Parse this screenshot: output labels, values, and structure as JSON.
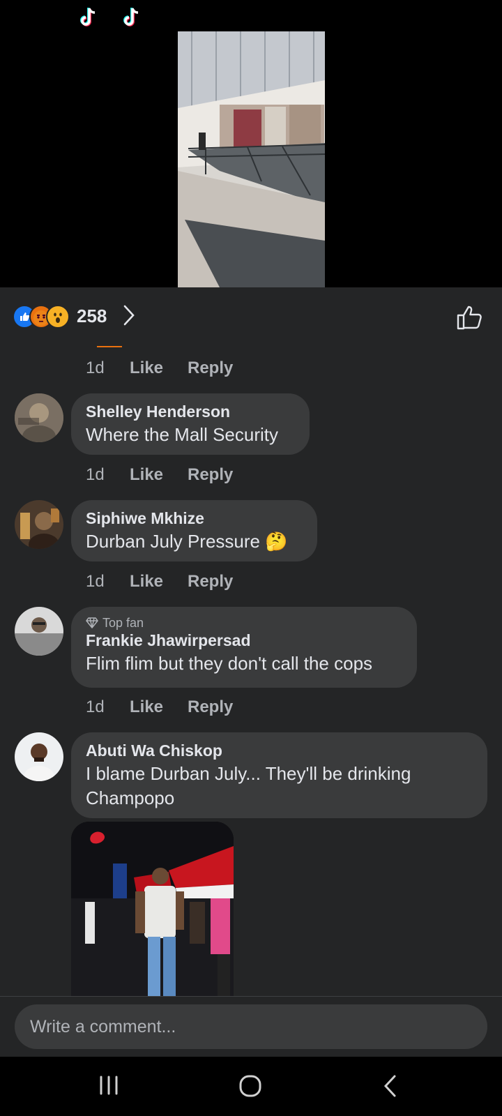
{
  "reactions": {
    "types": [
      "like",
      "angry",
      "wow"
    ],
    "count": "258"
  },
  "comments": [
    {
      "name": "",
      "text": "",
      "time": "1d",
      "like": "Like",
      "reply": "Reply"
    },
    {
      "name": "Shelley Henderson",
      "text": "Where the Mall Security",
      "time": "1d",
      "like": "Like",
      "reply": "Reply"
    },
    {
      "name": "Siphiwe Mkhize",
      "text": "Durban July Pressure",
      "emoji": "🤔",
      "time": "1d",
      "like": "Like",
      "reply": "Reply"
    },
    {
      "badge": "Top fan",
      "name": "Frankie Jhawirpersad",
      "text": "Flim flim but they don't call the cops",
      "time": "1d",
      "like": "Like",
      "reply": "Reply"
    },
    {
      "name": "Abuti Wa Chiskop",
      "text": "I blame Durban July... They'll be drinking Champopo",
      "has_photo": true
    }
  ],
  "composer": {
    "placeholder": "Write a comment..."
  },
  "colors": {
    "background": "#242526",
    "bubble": "#3a3b3c",
    "text": "#e4e6eb",
    "secondary": "#b0b3b8",
    "like_blue": "#1877f2"
  },
  "icons": [
    "tiktok-icon",
    "like-reaction-icon",
    "angry-reaction-icon",
    "wow-reaction-icon",
    "chevron-right-icon",
    "thumbs-up-outline-icon",
    "recents-icon",
    "home-icon",
    "back-icon"
  ]
}
